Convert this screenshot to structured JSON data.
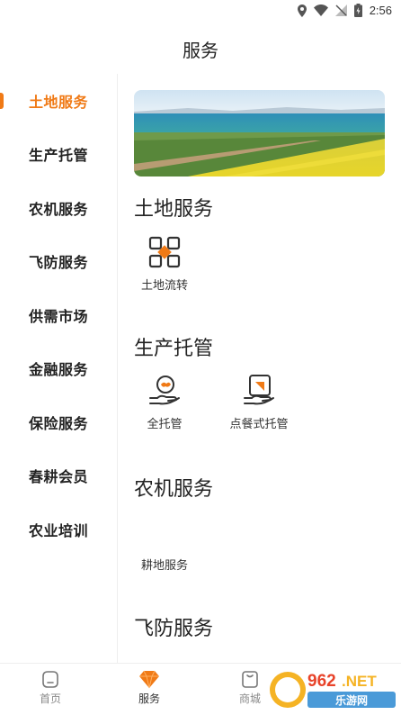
{
  "status_bar": {
    "time": "2:56"
  },
  "header": {
    "title": "服务"
  },
  "sidebar": {
    "items": [
      {
        "label": "土地服务",
        "active": true
      },
      {
        "label": "生产托管"
      },
      {
        "label": "农机服务"
      },
      {
        "label": "飞防服务"
      },
      {
        "label": "供需市场"
      },
      {
        "label": "金融服务"
      },
      {
        "label": "保险服务"
      },
      {
        "label": "春耕会员"
      },
      {
        "label": "农业培训"
      }
    ]
  },
  "main": {
    "sections": [
      {
        "title": "土地服务",
        "services": [
          {
            "label": "土地流转",
            "icon": "land-transfer-icon"
          }
        ]
      },
      {
        "title": "生产托管",
        "services": [
          {
            "label": "全托管",
            "icon": "full-custody-icon"
          },
          {
            "label": "点餐式托管",
            "icon": "menu-custody-icon"
          }
        ]
      },
      {
        "title": "农机服务",
        "services": [
          {
            "label": "耕地服务"
          }
        ]
      },
      {
        "title": "飞防服务",
        "services": []
      }
    ]
  },
  "bottom_nav": {
    "items": [
      {
        "label": "首页",
        "icon": "home-icon"
      },
      {
        "label": "服务",
        "icon": "diamond-icon",
        "active": true
      },
      {
        "label": "商城",
        "icon": "shop-icon"
      }
    ]
  },
  "watermark": {
    "text": "962.NET",
    "subtext": "乐游网"
  },
  "colors": {
    "accent": "#f07a16",
    "text": "#222222",
    "divider": "#eeeeee"
  }
}
